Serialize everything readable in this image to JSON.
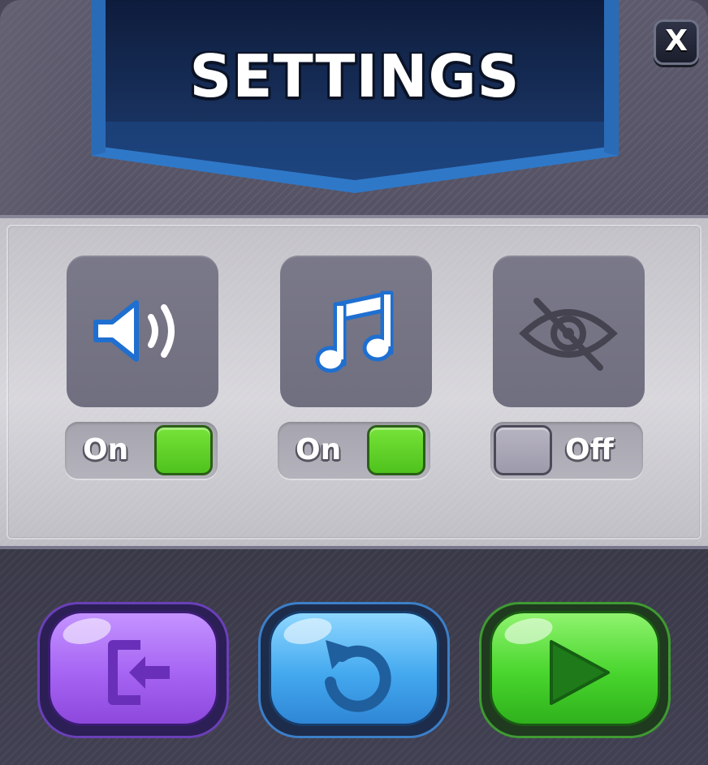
{
  "title": "SETTINGS",
  "close": {
    "label": "X"
  },
  "toggles": [
    {
      "id": "sound",
      "icon": "speaker-icon",
      "state_label": "On",
      "enabled": true
    },
    {
      "id": "music",
      "icon": "music-note-icon",
      "state_label": "On",
      "enabled": true
    },
    {
      "id": "visibility",
      "icon": "eye-off-icon",
      "state_label": "Off",
      "enabled": false
    }
  ],
  "actions": [
    {
      "id": "exit",
      "icon": "exit-door-icon",
      "color": "#a664f3"
    },
    {
      "id": "restart",
      "icon": "restart-icon",
      "color": "#44a9ef"
    },
    {
      "id": "play",
      "icon": "play-icon",
      "color": "#48d52d"
    }
  ],
  "colors": {
    "banner": "#16305c",
    "toggle_on": "#4fc21d",
    "toggle_off": "#9d9aab",
    "icon_active": "#ffffff",
    "icon_inactive": "#4a4858"
  }
}
